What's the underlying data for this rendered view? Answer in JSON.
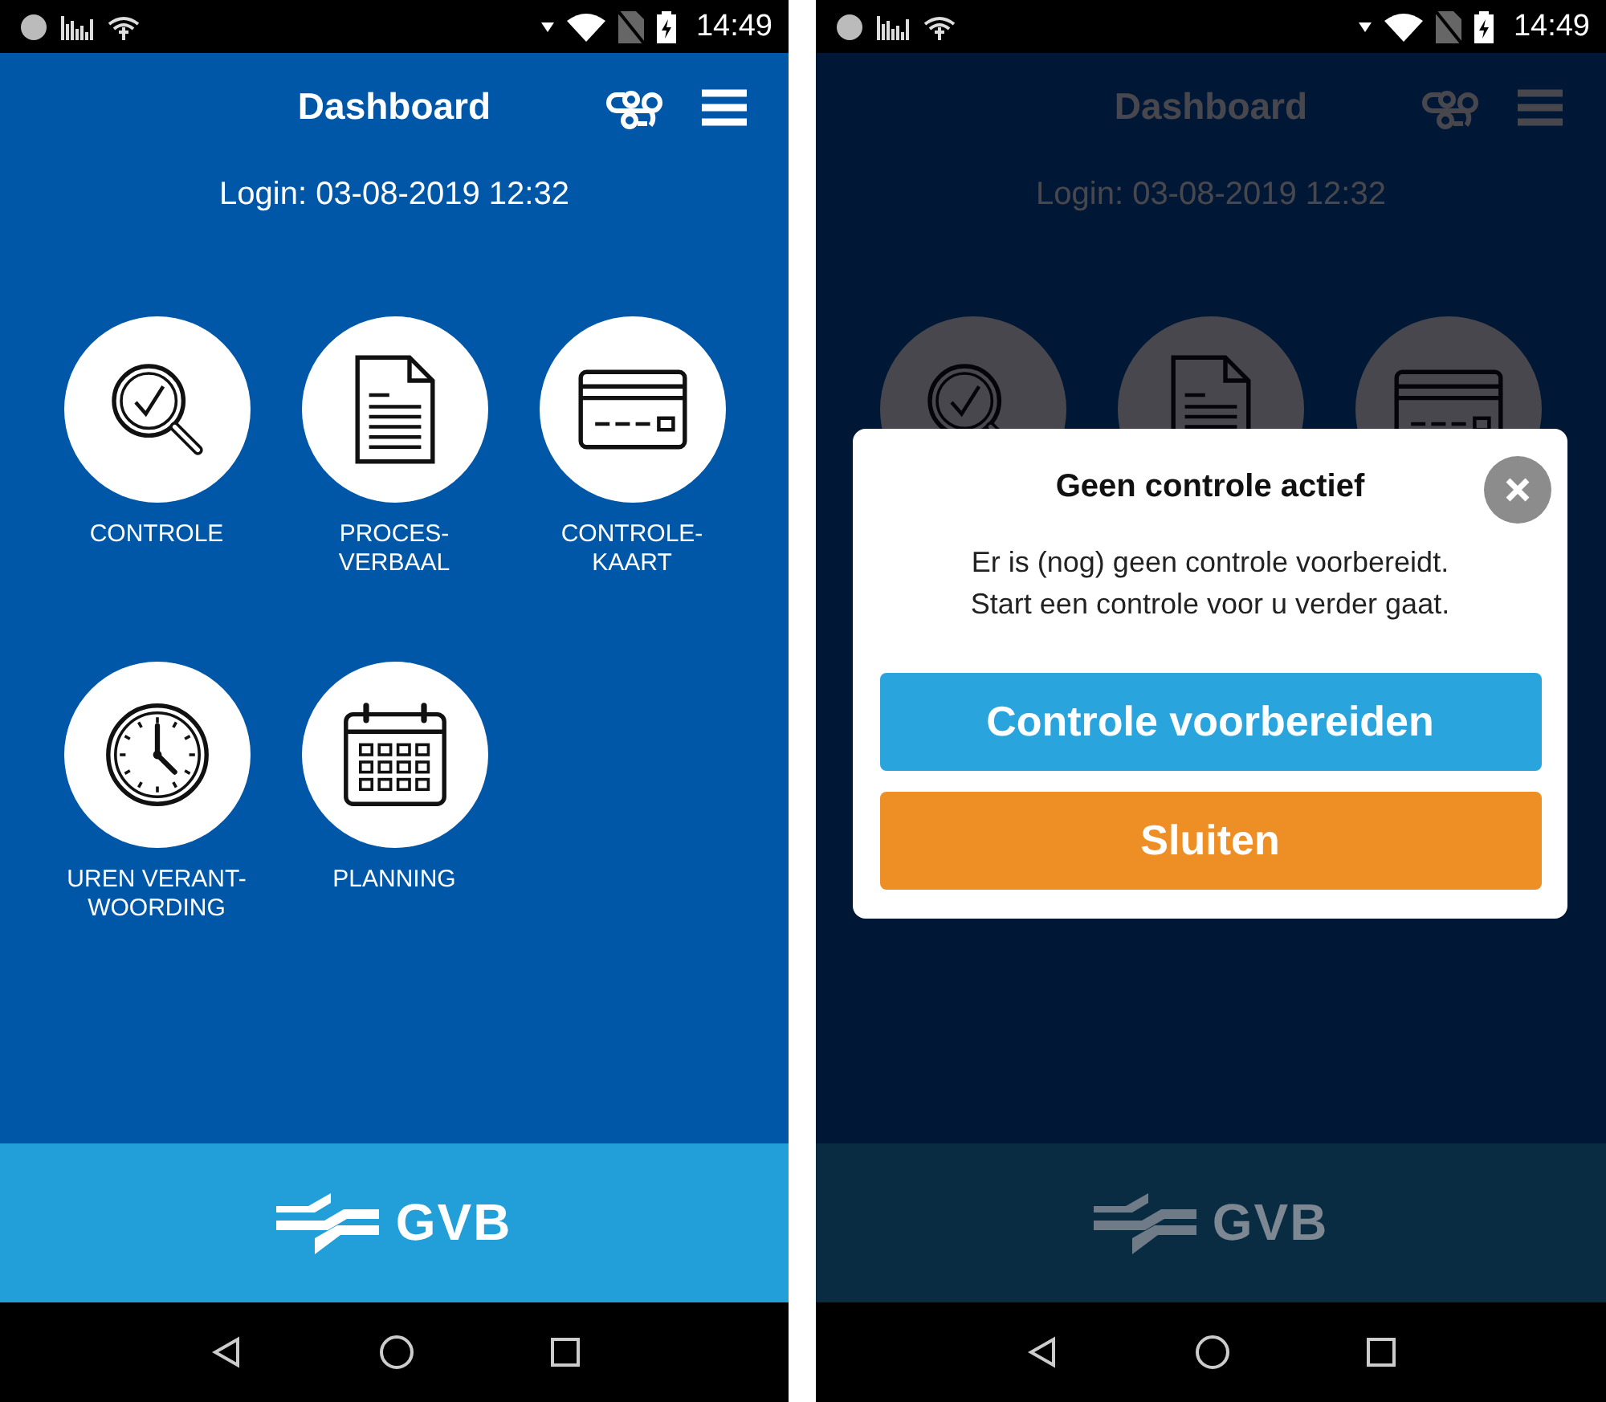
{
  "screens": [
    {
      "status_bar": {
        "time": "14:49"
      },
      "header": {
        "title": "Dashboard"
      },
      "login": "Login: 03-08-2019 12:32",
      "tiles": [
        {
          "kind": "search",
          "label_lines": [
            "CONTROLE"
          ]
        },
        {
          "kind": "document",
          "label_lines": [
            "PROCES-",
            "VERBAAL"
          ]
        },
        {
          "kind": "card",
          "label_lines": [
            "CONTROLE-",
            "KAART"
          ]
        },
        {
          "kind": "clock",
          "label_lines": [
            "UREN VERANT-",
            "WOORDING"
          ]
        },
        {
          "kind": "calendar",
          "label_lines": [
            "PLANNING"
          ]
        }
      ],
      "footer": {
        "logo_text": "GVB"
      }
    },
    {
      "status_bar": {
        "time": "14:49"
      },
      "header": {
        "title": "Dashboard"
      },
      "login": "Login: 03-08-2019 12:32",
      "tiles": [
        {
          "kind": "search"
        },
        {
          "kind": "document"
        },
        {
          "kind": "card"
        }
      ],
      "footer": {
        "logo_text": "GVB"
      },
      "dialog": {
        "title": "Geen controle actief",
        "message_lines": [
          "Er is (nog) geen controle voorbereidt.",
          "Start een controle voor u verder gaat."
        ],
        "buttons": [
          {
            "kind": "primary",
            "label": "Controle voorbereiden"
          },
          {
            "kind": "secondary",
            "label": "Sluiten"
          }
        ]
      }
    }
  ]
}
